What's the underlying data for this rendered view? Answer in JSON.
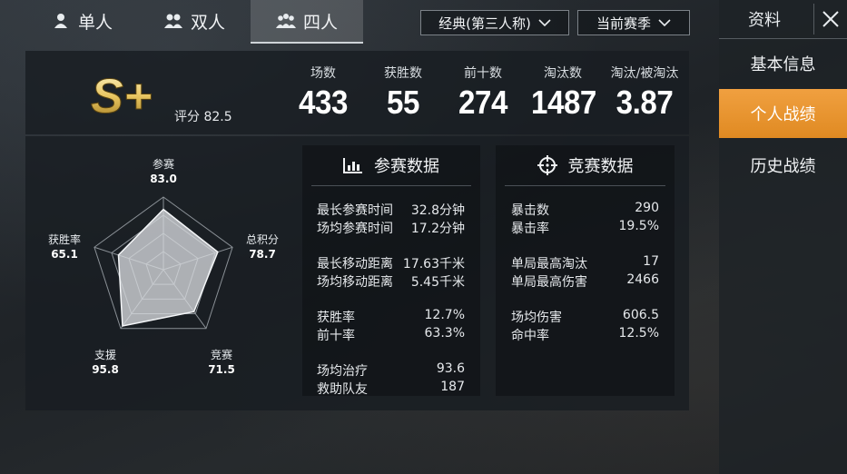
{
  "tabs": [
    {
      "label": "单人",
      "icon": "single-person-icon"
    },
    {
      "label": "双人",
      "icon": "duo-icon"
    },
    {
      "label": "四人",
      "icon": "squad-icon"
    }
  ],
  "active_tab": "四人",
  "dropdowns": {
    "mode": "经典(第三人称)",
    "season": "当前赛季"
  },
  "side": {
    "title": "资料",
    "items": [
      "基本信息",
      "个人战绩",
      "历史战绩"
    ],
    "active": "个人战绩",
    "accent": "#e89030"
  },
  "grade": {
    "tier": "S+",
    "rating_text": "评分 82.5"
  },
  "summary": [
    {
      "label": "场数",
      "value": "433"
    },
    {
      "label": "获胜数",
      "value": "55"
    },
    {
      "label": "前十数",
      "value": "274"
    },
    {
      "label": "淘汰数",
      "value": "1487"
    },
    {
      "label": "淘汰/被淘汰",
      "value": "3.87"
    }
  ],
  "radar": {
    "axes": [
      {
        "label": "参赛",
        "value": "83.0",
        "v": 83.0
      },
      {
        "label": "总积分",
        "value": "78.7",
        "v": 78.7
      },
      {
        "label": "竞赛",
        "value": "71.5",
        "v": 71.5
      },
      {
        "label": "支援",
        "value": "95.8",
        "v": 95.8
      },
      {
        "label": "获胜率",
        "value": "65.1",
        "v": 65.1
      }
    ]
  },
  "participation": {
    "title": "参赛数据",
    "groups": [
      [
        {
          "k": "最长参赛时间",
          "v": "32.8分钟"
        },
        {
          "k": "场均参赛时间",
          "v": "17.2分钟"
        }
      ],
      [
        {
          "k": "最长移动距离",
          "v": "17.63千米"
        },
        {
          "k": "场均移动距离",
          "v": "5.45千米"
        }
      ],
      [
        {
          "k": "获胜率",
          "v": "12.7%"
        },
        {
          "k": "前十率",
          "v": "63.3%"
        }
      ],
      [
        {
          "k": "场均治疗",
          "v": "93.6"
        },
        {
          "k": "救助队友",
          "v": "187"
        }
      ]
    ]
  },
  "competition": {
    "title": "竞赛数据",
    "groups": [
      [
        {
          "k": "暴击数",
          "v": "290"
        },
        {
          "k": "暴击率",
          "v": "19.5%"
        }
      ],
      [
        {
          "k": "单局最高淘汰",
          "v": "17"
        },
        {
          "k": "单局最高伤害",
          "v": "2466"
        }
      ],
      [
        {
          "k": "场均伤害",
          "v": "606.5"
        },
        {
          "k": "命中率",
          "v": "12.5%"
        }
      ]
    ]
  }
}
